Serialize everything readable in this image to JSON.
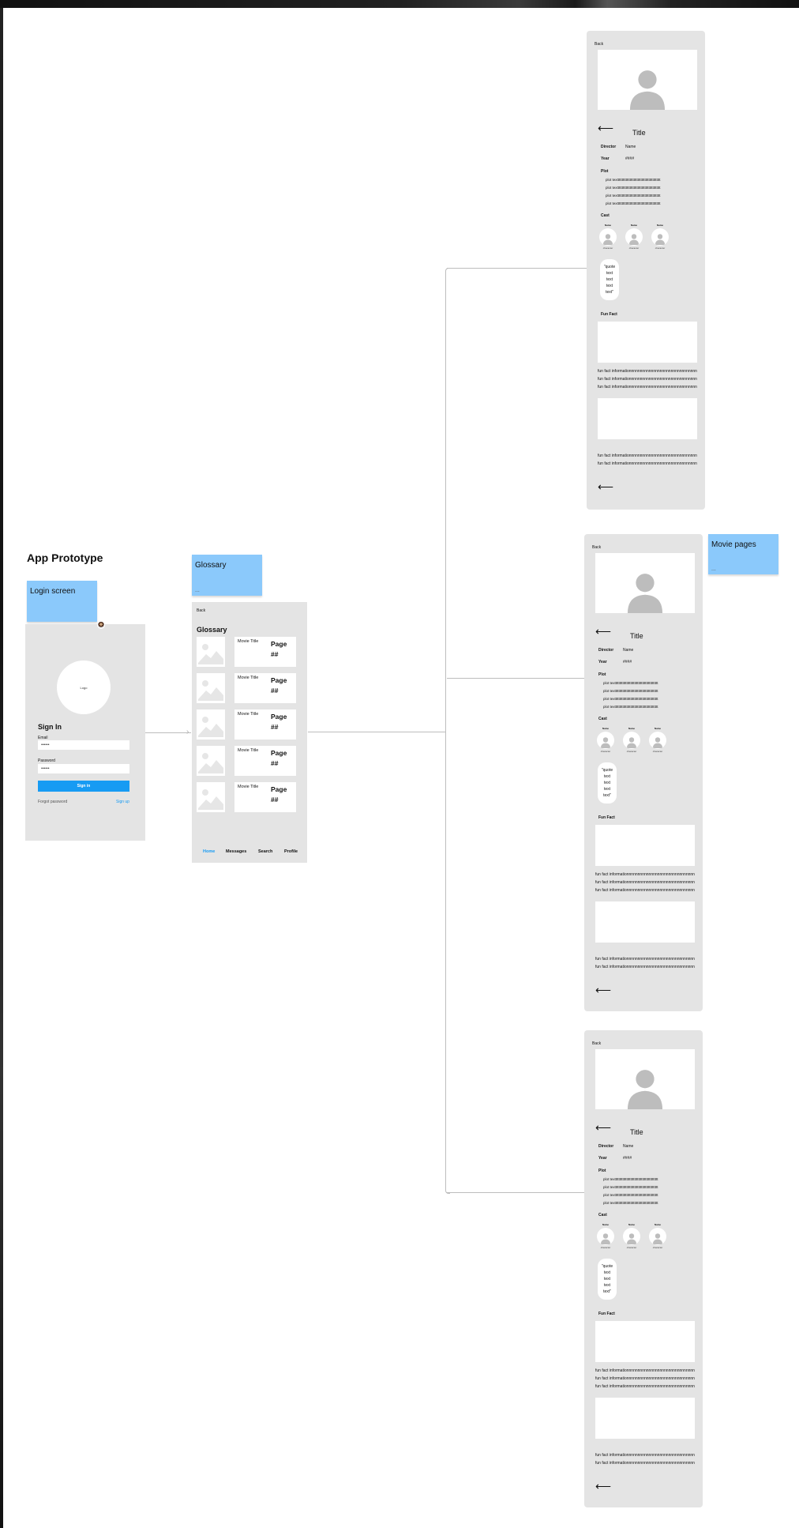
{
  "canvas": {
    "title": "App Prototype"
  },
  "stickies": {
    "login": {
      "title": "Login screen",
      "dots": "..."
    },
    "glossary": {
      "title": "Glossary",
      "dots": "..."
    },
    "movie": {
      "title": "Movie pages",
      "dots": "..."
    }
  },
  "login": {
    "logo_text": "Logo",
    "heading": "Sign In",
    "email_label": "Email",
    "email_value": "••••••",
    "password_label": "Password",
    "password_value": "••••••",
    "signin_button": "Sign in",
    "forgot_link": "Forgot password",
    "signup_link": "Sign up"
  },
  "glossary": {
    "back": "Back",
    "heading": "Glossary",
    "items": [
      {
        "title": "Movie Title",
        "page": "Page ##"
      },
      {
        "title": "Movie Title",
        "page": "Page ##"
      },
      {
        "title": "Movie Title",
        "page": "Page ##"
      },
      {
        "title": "Movie Title",
        "page": "Page ##"
      },
      {
        "title": "Movie Title",
        "page": "Page ##"
      }
    ],
    "nav": {
      "home": "Home",
      "messages": "Messages",
      "search": "Search",
      "profile": "Profile"
    },
    "accent": "#179bf3"
  },
  "movie": {
    "back": "Back",
    "arrow": "⟵",
    "title": "Title",
    "director_label": "Director",
    "director_value": "Name",
    "year_label": "Year",
    "year_value": "####",
    "plot_label": "Plot",
    "plot_lines": [
      "plot textttttttttttttttttttttttttttttttttttttttttttt",
      "plot textttttttttttttttttttttttttttttttttttttttttttt",
      "plot textttttttttttttttttttttttttttttttttttttttttttt",
      "plot textttttttttttttttttttttttttttttttttttttttttttt"
    ],
    "cast_label": "Cast",
    "cast": [
      {
        "name": "Name",
        "character": "character"
      },
      {
        "name": "Name",
        "character": "character"
      },
      {
        "name": "Name",
        "character": "character"
      }
    ],
    "quote_lines": [
      "\"quote",
      "text",
      "text",
      "text",
      "text\""
    ],
    "funfact_label": "Fun Fact",
    "funfact_lines_a": [
      "fun fact informationnnnnnnnnnnnnnnnnnnnnnnnnnnnnnn",
      "fun fact informationnnnnnnnnnnnnnnnnnnnnnnnnnnnnnn",
      "fun fact informationnnnnnnnnnnnnnnnnnnnnnnnnnnnnnn"
    ],
    "funfact_lines_b": [
      "fun fact informationnnnnnnnnnnnnnnnnnnnnnnnnnnnnnn",
      "fun fact informationnnnnnnnnnnnnnnnnnnnnnnnnnnnnnn"
    ]
  }
}
